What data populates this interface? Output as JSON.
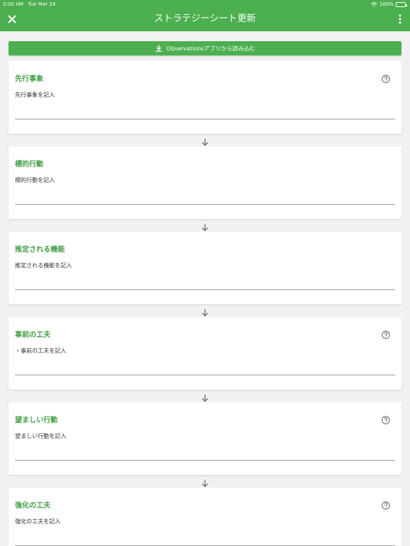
{
  "status_bar": {
    "time": "2:00 AM",
    "date": "Tue Mar 24",
    "battery": "100%"
  },
  "app_bar": {
    "title": "ストラテジーシート更新",
    "close_icon": "close-icon",
    "menu_icon": "more-vertical-icon"
  },
  "import_button": {
    "label": "Observationsアプリから読み込む",
    "icon": "download-icon"
  },
  "colors": {
    "primary": "#4caf50",
    "title_green": "#43a047",
    "background": "#f1f1f1"
  },
  "cards": [
    {
      "title": "先行事象",
      "value": "先行事象を記入",
      "has_help": true
    },
    {
      "title": "標的行動",
      "value": "標的行動を記入",
      "has_help": false
    },
    {
      "title": "推定される機能",
      "value": "推定される機能を記入",
      "has_help": false
    },
    {
      "title": "事前の工夫",
      "value": "・事前の工夫を記入",
      "has_help": true
    },
    {
      "title": "望ましい行動",
      "value": "望ましい行動を記入",
      "has_help": true
    },
    {
      "title": "強化の工夫",
      "value": "強化の工夫を記入",
      "has_help": true
    }
  ]
}
